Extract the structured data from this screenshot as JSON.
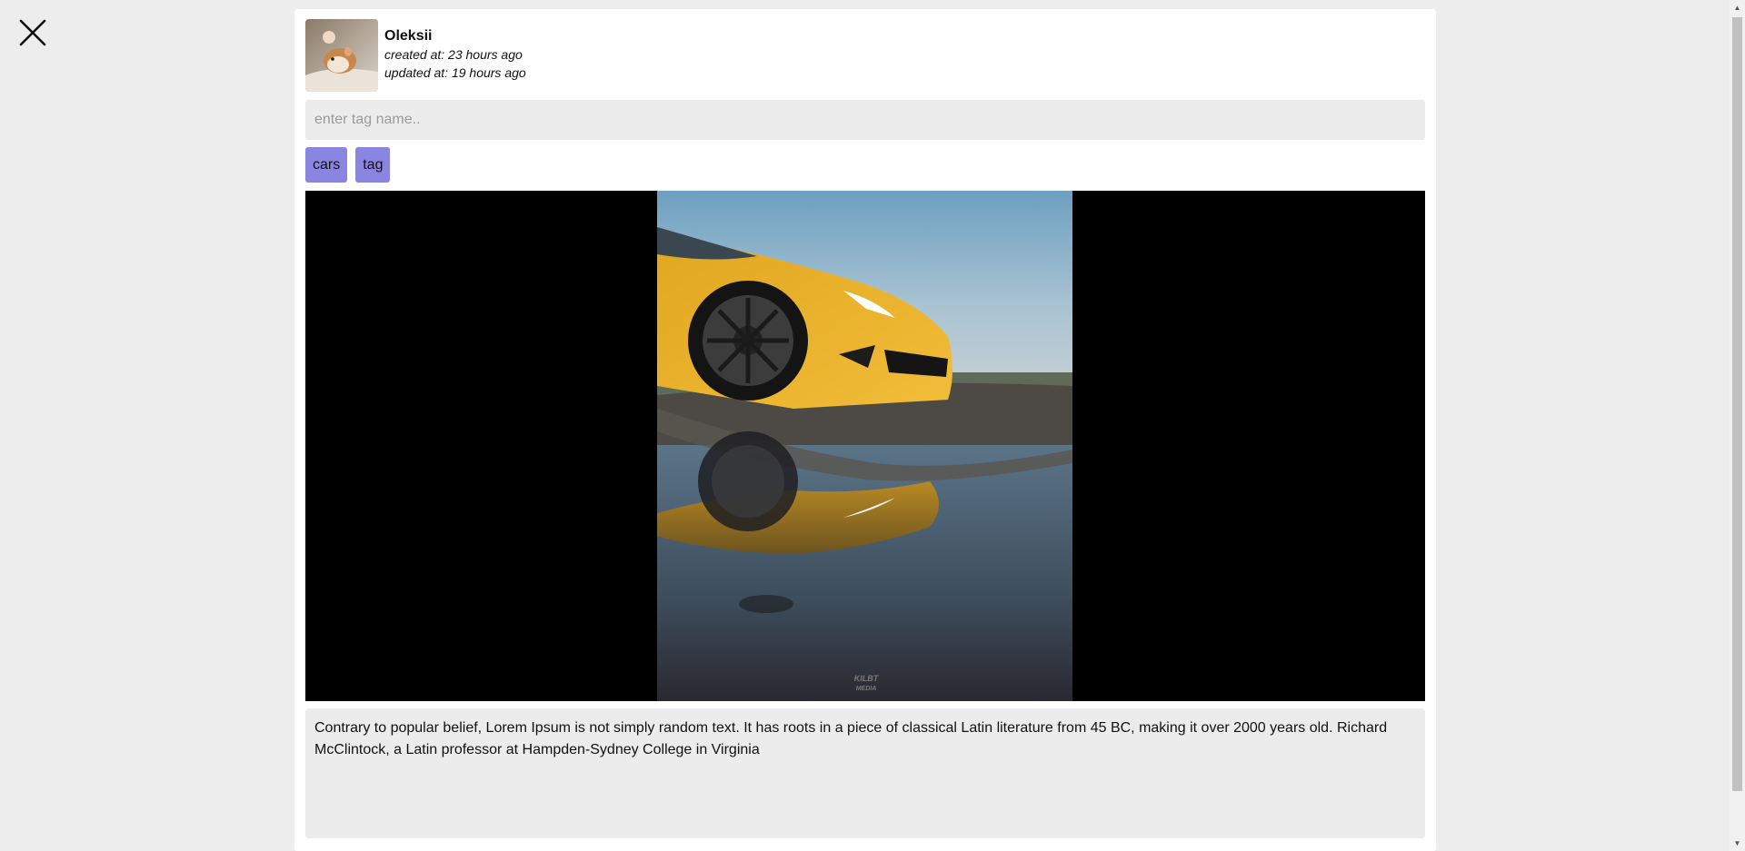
{
  "close": {
    "icon": "close-icon"
  },
  "author": {
    "name": "Oleksii",
    "created": "created at: 23 hours ago",
    "updated": "updated at: 19 hours ago",
    "avatar_icon": "avatar-hamster-photo"
  },
  "tag_input": {
    "placeholder": "enter tag name..",
    "value": ""
  },
  "tags": [
    "cars",
    "tag"
  ],
  "media": {
    "description": "photo of yellow sports car reflected in puddle",
    "watermark": "KILBT MEDIA"
  },
  "post": {
    "text": "Contrary to popular belief, Lorem Ipsum is not simply random text. It has roots in a piece of classical Latin literature from 45 BC, making it over 2000 years old. Richard McClintock, a Latin professor at Hampden-Sydney College in Virginia"
  },
  "colors": {
    "tag_bg": "#8b85e2",
    "page_bg": "#ededed",
    "field_bg": "#ececec"
  }
}
